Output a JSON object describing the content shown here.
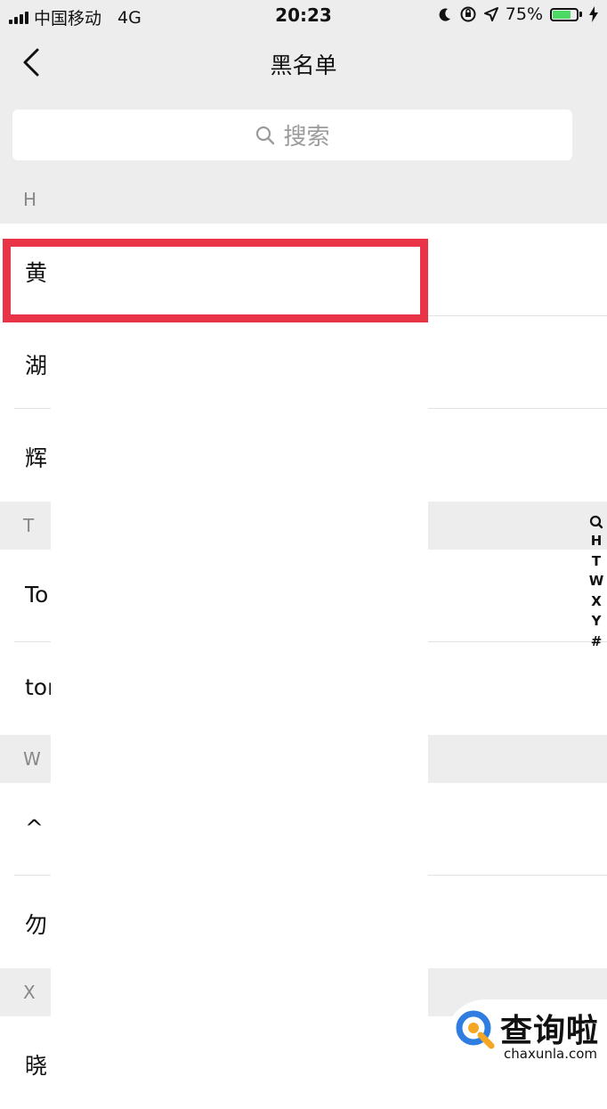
{
  "status_bar": {
    "carrier": "中国移动",
    "network": "4G",
    "time": "20:23",
    "battery": "75%",
    "battery_level": 0.75,
    "battery_color": "#4cd964",
    "icons": [
      "signal-icon",
      "moon-icon",
      "orientation-lock-icon",
      "location-icon",
      "battery-icon",
      "charging-icon"
    ]
  },
  "nav": {
    "title": "黑名单",
    "back_icon": "back-chevron-icon"
  },
  "search": {
    "placeholder": "搜索",
    "icon": "search-icon"
  },
  "sections": [
    {
      "letter": "H",
      "items": [
        "黄",
        "湖",
        "辉"
      ]
    },
    {
      "letter": "T",
      "items": [
        "To",
        "tor"
      ]
    },
    {
      "letter": "W",
      "items": [
        "^",
        "勿"
      ]
    },
    {
      "letter": "X",
      "items": [
        "晓"
      ]
    }
  ],
  "index_bar": [
    "H",
    "T",
    "W",
    "X",
    "Y",
    "#"
  ],
  "highlight_color": "#e93447",
  "watermark": {
    "name": "查询啦",
    "url": "chaxunla.com",
    "logo_colors": [
      "#2f7de1",
      "#f5a623"
    ]
  }
}
